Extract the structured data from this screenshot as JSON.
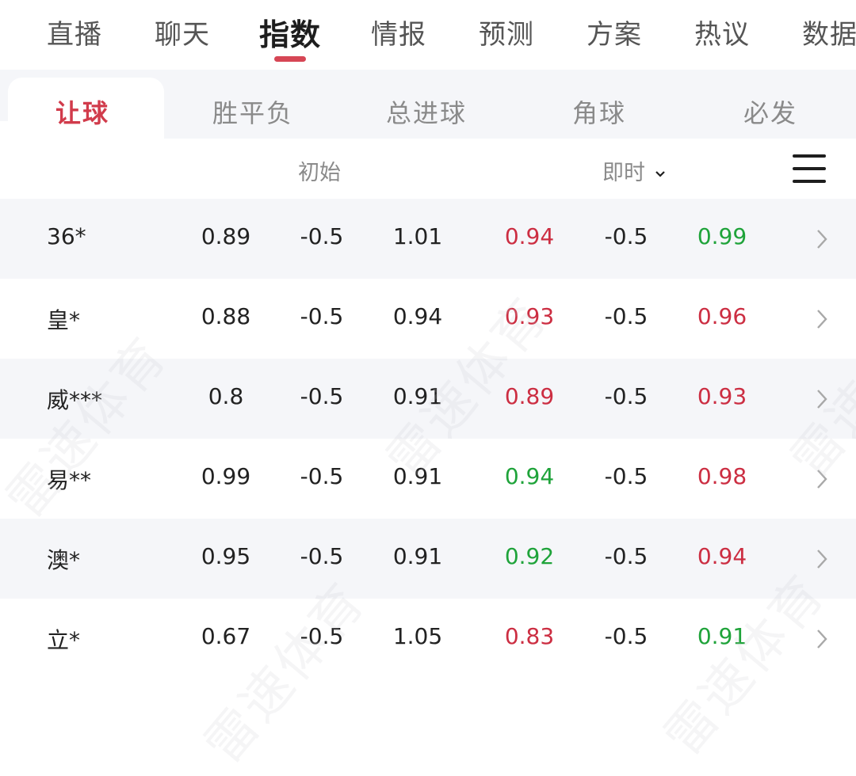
{
  "top_nav": {
    "items": [
      "直播",
      "聊天",
      "指数",
      "情报",
      "预测",
      "方案",
      "热议",
      "数据"
    ],
    "active_index": 2,
    "accent_color": "#d64655"
  },
  "sub_tabs": {
    "items": [
      "让球",
      "胜平负",
      "总进球",
      "角球",
      "必发"
    ],
    "active_index": 0
  },
  "column_header": {
    "initial_label": "初始",
    "live_label": "即时",
    "live_dropdown_icon": "chevron-down-icon",
    "menu_icon": "hamburger-menu-icon"
  },
  "colors": {
    "up": "#cc2e42",
    "down": "#1fa33a",
    "neutral": "#222222"
  },
  "rows": [
    {
      "company": "36*",
      "init_home": "0.89",
      "init_line": "-0.5",
      "init_away": "1.01",
      "live_home": "0.94",
      "live_home_trend": "up",
      "live_line": "-0.5",
      "live_away": "0.99",
      "live_away_trend": "down"
    },
    {
      "company": "皇*",
      "init_home": "0.88",
      "init_line": "-0.5",
      "init_away": "0.94",
      "live_home": "0.93",
      "live_home_trend": "up",
      "live_line": "-0.5",
      "live_away": "0.96",
      "live_away_trend": "up"
    },
    {
      "company": "威***",
      "init_home": "0.8",
      "init_line": "-0.5",
      "init_away": "0.91",
      "live_home": "0.89",
      "live_home_trend": "up",
      "live_line": "-0.5",
      "live_away": "0.93",
      "live_away_trend": "up"
    },
    {
      "company": "易**",
      "init_home": "0.99",
      "init_line": "-0.5",
      "init_away": "0.91",
      "live_home": "0.94",
      "live_home_trend": "down",
      "live_line": "-0.5",
      "live_away": "0.98",
      "live_away_trend": "up"
    },
    {
      "company": "澳*",
      "init_home": "0.95",
      "init_line": "-0.5",
      "init_away": "0.91",
      "live_home": "0.92",
      "live_home_trend": "down",
      "live_line": "-0.5",
      "live_away": "0.94",
      "live_away_trend": "up"
    },
    {
      "company": "立*",
      "init_home": "0.67",
      "init_line": "-0.5",
      "init_away": "1.05",
      "live_home": "0.83",
      "live_home_trend": "up",
      "live_line": "-0.5",
      "live_away": "0.91",
      "live_away_trend": "down"
    }
  ],
  "watermark": "雷速体育"
}
